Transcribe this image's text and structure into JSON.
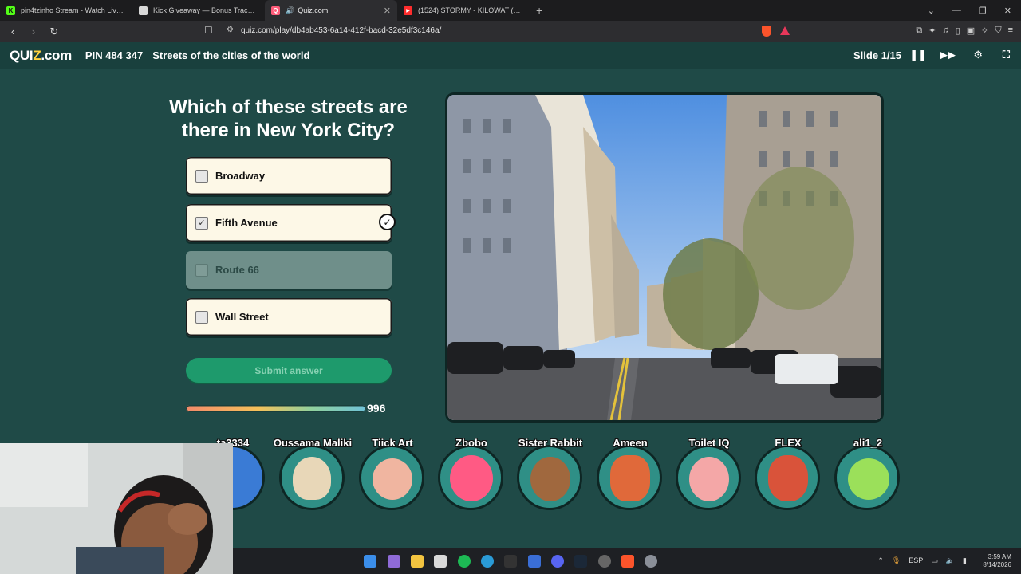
{
  "browser": {
    "tabs": [
      {
        "title": "pin4tzinho Stream - Watch Live on K",
        "favicon_color": "#53fc18",
        "favicon_glyph": "K"
      },
      {
        "title": "Kick Giveaway — Bonus Tracker | Bor",
        "favicon_color": "#d8d8d8",
        "favicon_glyph": ""
      },
      {
        "title": "Quiz.com",
        "favicon_color": "#ff5c7a",
        "favicon_glyph": "Q",
        "active": true,
        "audio": true
      },
      {
        "title": "(1524) STORMY - KILOWAT (VISUALIZ",
        "favicon_color": "#ff2d2d",
        "favicon_glyph": "▶"
      }
    ],
    "new_tab": "+",
    "url": "quiz.com/play/db4ab453-6a14-412f-bacd-32e5df3c146a/"
  },
  "header": {
    "logo_prefix": "QUI",
    "logo_z": "Z",
    "logo_suffix": ".com",
    "pin": "PIN 484 347",
    "quiz_title": "Streets of the cities of the world",
    "slide": "Slide 1/15"
  },
  "question": {
    "text": "Which of these streets are there in New York City?",
    "options": [
      {
        "label": "Broadway",
        "checked": false,
        "dimmed": false
      },
      {
        "label": "Fifth Avenue",
        "checked": true,
        "dimmed": false,
        "confirmed": true
      },
      {
        "label": "Route 66",
        "checked": false,
        "dimmed": true
      },
      {
        "label": "Wall Street",
        "checked": false,
        "dimmed": false
      }
    ],
    "submit_label": "Submit answer",
    "timer_value": "996"
  },
  "players": [
    {
      "name": "ta3334",
      "color": "#3a7bd5"
    },
    {
      "name": "Oussama Maliki",
      "color": "#2f8f86"
    },
    {
      "name": "Tiick Art",
      "color": "#2f8f86"
    },
    {
      "name": "Zbobo",
      "color": "#2f8f86"
    },
    {
      "name": "Sister Rabbit",
      "color": "#2f8f86"
    },
    {
      "name": "Ameen",
      "color": "#2f8f86"
    },
    {
      "name": "Toilet IQ",
      "color": "#2f8f86"
    },
    {
      "name": "FLEX",
      "color": "#2f8f86"
    },
    {
      "name": "ali1_2",
      "color": "#2f8f86"
    }
  ],
  "taskbar": {
    "lang": "ESP",
    "time": "3:59 AM",
    "date": "8/14/2026"
  }
}
